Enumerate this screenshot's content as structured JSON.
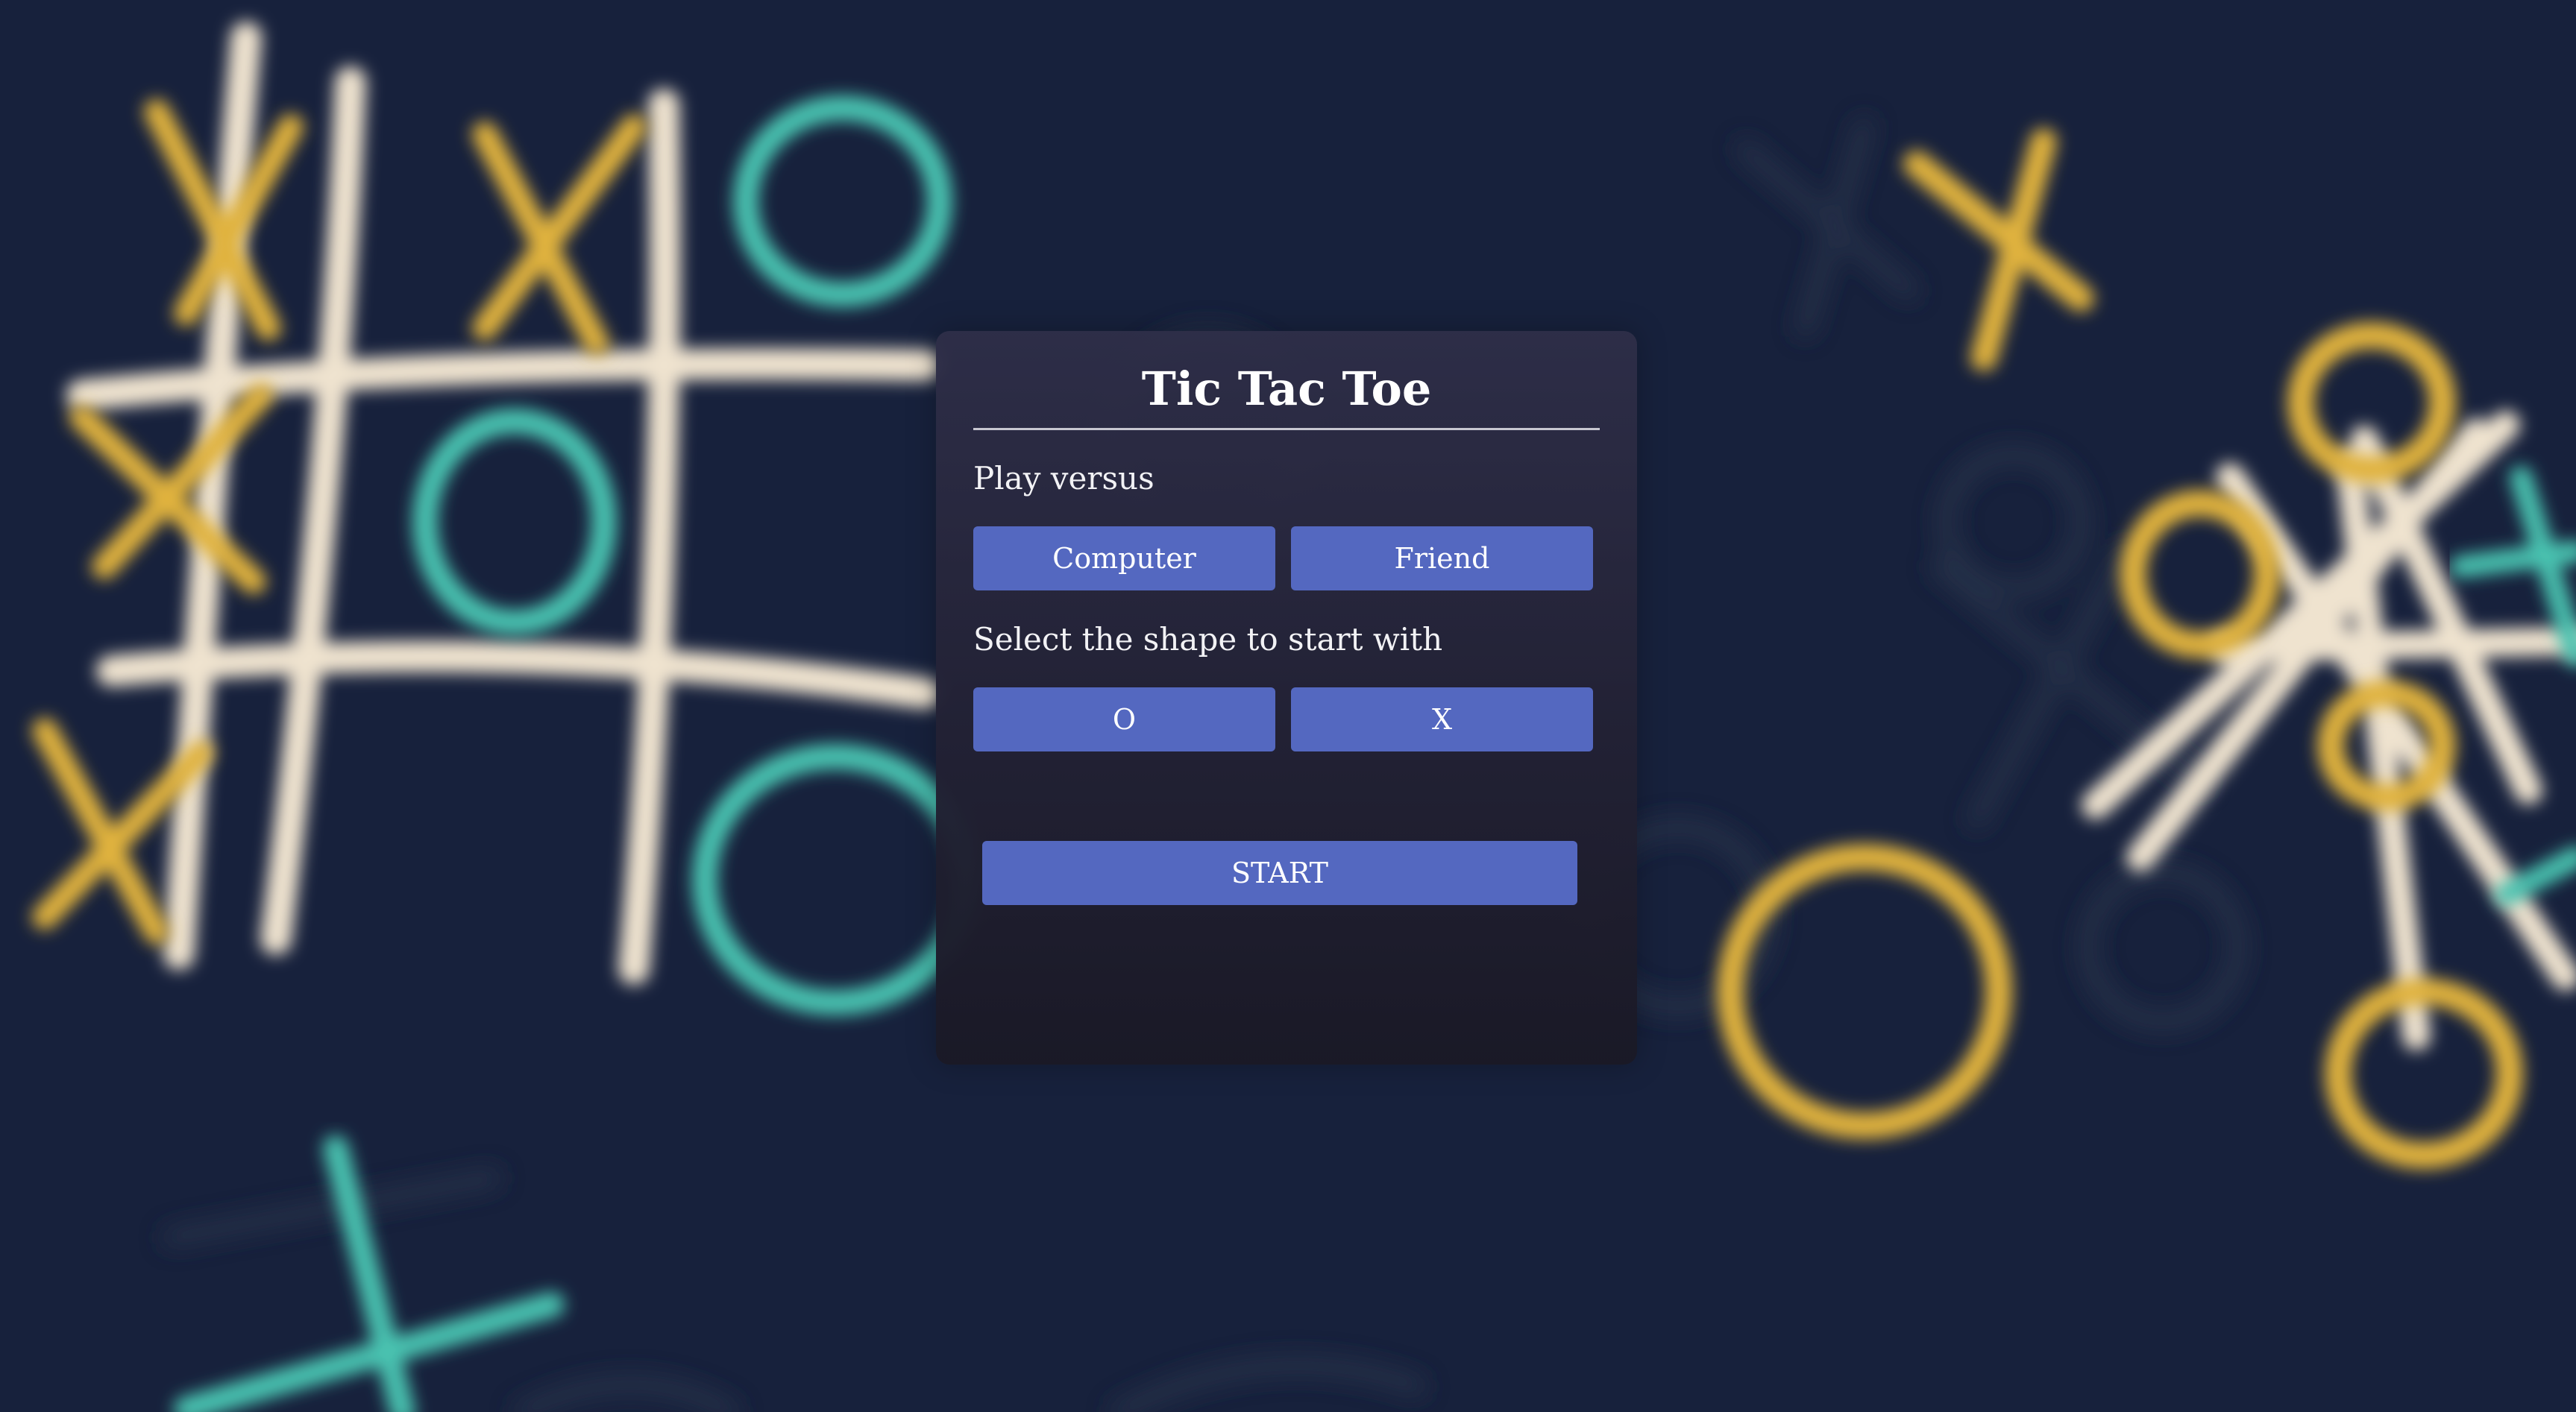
{
  "app": {
    "title": "Tic Tac Toe"
  },
  "opponent_section": {
    "label": "Play versus",
    "options": [
      "Computer",
      "Friend"
    ]
  },
  "shape_section": {
    "label": "Select the shape to start with",
    "options": [
      "O",
      "X"
    ]
  },
  "actions": {
    "start_label": "START"
  },
  "colors": {
    "background": "#17213c",
    "panel": "#2a2a40",
    "button": "#5468c0",
    "button_text": "#ffffff",
    "text": "#f2f2f5",
    "doodle_chalk": "#efe3cf",
    "doodle_yellow": "#e0b23c",
    "doodle_teal": "#49c2b0"
  }
}
